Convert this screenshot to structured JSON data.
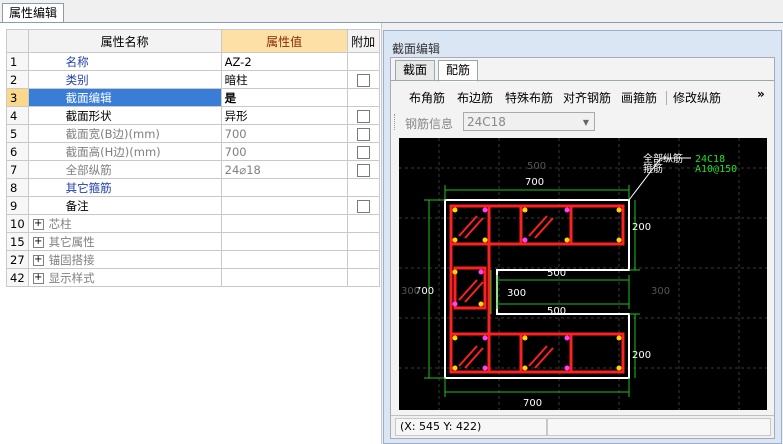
{
  "panel_tab": "属性编辑",
  "table": {
    "headers": {
      "name": "属性名称",
      "value": "属性值",
      "extra": "附加"
    },
    "rows": [
      {
        "num": "1",
        "name": "名称",
        "value": "AZ-2",
        "style": "blue",
        "checkbox": false
      },
      {
        "num": "2",
        "name": "类别",
        "value": "暗柱",
        "style": "blue",
        "checkbox": true
      },
      {
        "num": "3",
        "name": "截面编辑",
        "value": "是",
        "style": "selected",
        "checkbox": false
      },
      {
        "num": "4",
        "name": "截面形状",
        "value": "异形",
        "style": "normal",
        "checkbox": true
      },
      {
        "num": "5",
        "name": "截面宽(B边)(mm)",
        "value": "700",
        "style": "gray",
        "checkbox": true
      },
      {
        "num": "6",
        "name": "截面高(H边)(mm)",
        "value": "700",
        "style": "gray",
        "checkbox": true
      },
      {
        "num": "7",
        "name": "全部纵筋",
        "value": "24⌀18",
        "style": "gray",
        "checkbox": true
      },
      {
        "num": "8",
        "name": "其它箍筋",
        "value": "",
        "style": "blue",
        "checkbox": false
      },
      {
        "num": "9",
        "name": "备注",
        "value": "",
        "style": "normal",
        "checkbox": true
      },
      {
        "num": "10",
        "name": "芯柱",
        "value": "",
        "style": "group",
        "checkbox": false
      },
      {
        "num": "15",
        "name": "其它属性",
        "value": "",
        "style": "group",
        "checkbox": false
      },
      {
        "num": "27",
        "name": "锚固搭接",
        "value": "",
        "style": "group",
        "checkbox": false
      },
      {
        "num": "42",
        "name": "显示样式",
        "value": "",
        "style": "group",
        "checkbox": false
      }
    ]
  },
  "section_editor": {
    "title": "截面编辑",
    "tabs": [
      "截面",
      "配筋"
    ],
    "toolbar": [
      "布角筋",
      "布边筋",
      "特殊布筋",
      "对齐钢筋",
      "画箍筋",
      "修改纵筋"
    ],
    "overflow": "»",
    "rebar_info_label": "钢筋信息",
    "rebar_info_value": "24C18",
    "drawing": {
      "callout_labels": [
        "全部纵筋",
        "箍筋"
      ],
      "callout_values": [
        "24C18",
        "A10@150"
      ],
      "dimensions": [
        "500",
        "700",
        "200",
        "500",
        "300",
        "700",
        "500",
        "200",
        "700",
        "300",
        "300"
      ]
    },
    "status_coords": "(X: 545 Y: 422)"
  },
  "colors": {
    "selected_row": "#3a7dd6",
    "value_header": "#fde0a6",
    "stirrup": "#ff2020",
    "outline": "#ffffff",
    "dimension": "#20c020"
  }
}
